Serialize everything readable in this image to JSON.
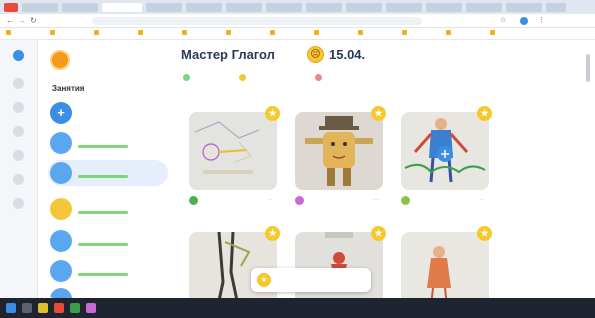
{
  "browser": {
    "url": "",
    "bookmarks": [
      "",
      "",
      "",
      "",
      "",
      "",
      "",
      "",
      "",
      "",
      "",
      ""
    ]
  },
  "sidebar": {
    "profile_name": "",
    "section_title": "Занятия",
    "items": [
      {
        "label": "",
        "active": false,
        "icon": "plus-icon"
      },
      {
        "label": "",
        "active": false,
        "icon": "avatar"
      },
      {
        "label": "",
        "active": true,
        "icon": "avatar"
      },
      {
        "label": "",
        "active": false,
        "icon": "avatar"
      },
      {
        "label": "",
        "active": false,
        "icon": "avatar"
      },
      {
        "label": "",
        "active": false,
        "icon": "avatar"
      },
      {
        "label": "",
        "active": false,
        "icon": "avatar"
      }
    ]
  },
  "main": {
    "title": "Мастер Глагол",
    "emoji": "☹",
    "date": "15.04.",
    "title_link": "",
    "filters": [
      {
        "label": "",
        "color": "#7cd67c"
      },
      {
        "label": "",
        "color": "#f6c63a"
      },
      {
        "label": "",
        "color": "#e88a8a"
      }
    ],
    "cards": [
      {
        "author_name": "",
        "author_surname": "",
        "avatar_color": "#4caf50"
      },
      {
        "author_name": "",
        "author_surname": "",
        "avatar_color": "#c86ad6"
      },
      {
        "author_name": "",
        "author_surname": "",
        "avatar_color": "#8bc34a"
      },
      {
        "author_name": "",
        "author_surname": "",
        "avatar_color": "#4caf50"
      },
      {
        "author_name": "",
        "author_surname": "",
        "avatar_color": "#c86ad6"
      },
      {
        "author_name": "",
        "author_surname": "",
        "avatar_color": "#8bc34a"
      }
    ],
    "toast_text": ""
  },
  "colors": {
    "accent": "#3a8ee6",
    "star": "#f8c82a",
    "title": "#2a3b55"
  },
  "taskbar": {
    "tray": ""
  }
}
